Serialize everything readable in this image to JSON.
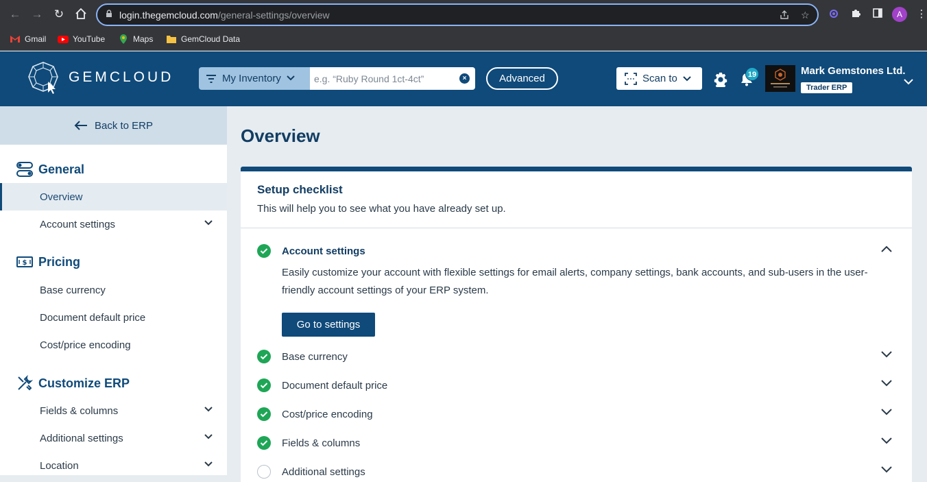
{
  "browser": {
    "url_domain": "login.thegemcloud.com",
    "url_path": "/general-settings/overview",
    "profile_initial": "A",
    "bookmarks": [
      {
        "label": "Gmail",
        "icon": "gmail-icon"
      },
      {
        "label": "YouTube",
        "icon": "youtube-icon"
      },
      {
        "label": "Maps",
        "icon": "maps-icon"
      },
      {
        "label": "GemCloud Data",
        "icon": "folder-icon"
      }
    ]
  },
  "header": {
    "logo_text": "GEMCLOUD",
    "inventory_label": "My Inventory",
    "search_placeholder": "e.g. “Ruby Round 1ct-4ct”",
    "advanced_label": "Advanced",
    "scan_label": "Scan to",
    "notification_count": "19",
    "company_name": "Mark Gemstones Ltd.",
    "erp_tag": "Trader ERP",
    "accent": "#0f4a7a"
  },
  "sidebar": {
    "back_label": "Back to ERP",
    "sections": [
      {
        "title": "General",
        "icon": "toggles-icon",
        "items": [
          {
            "label": "Overview",
            "active": true,
            "has_chevron": false
          },
          {
            "label": "Account settings",
            "has_chevron": true
          }
        ]
      },
      {
        "title": "Pricing",
        "icon": "money-icon",
        "items": [
          {
            "label": "Base currency"
          },
          {
            "label": "Document default price"
          },
          {
            "label": "Cost/price encoding"
          }
        ]
      },
      {
        "title": "Customize ERP",
        "icon": "tools-icon",
        "items": [
          {
            "label": "Fields & columns",
            "has_chevron": true
          },
          {
            "label": "Additional settings",
            "has_chevron": true
          },
          {
            "label": "Location",
            "has_chevron": true
          }
        ]
      }
    ]
  },
  "main": {
    "title": "Overview",
    "checklist": {
      "title": "Setup checklist",
      "subtitle": "This will help you to see what you have already set up.",
      "expanded": {
        "label": "Account settings",
        "description": "Easily customize your account with flexible settings for email alerts, company settings, bank accounts, and sub-users in the user-friendly account settings of your ERP system.",
        "button": "Go to settings"
      },
      "items": [
        {
          "label": "Base currency",
          "done": true
        },
        {
          "label": "Document default price",
          "done": true
        },
        {
          "label": "Cost/price encoding",
          "done": true
        },
        {
          "label": "Fields & columns",
          "done": true
        },
        {
          "label": "Additional settings",
          "done": false
        }
      ],
      "done_color": "#1ea656"
    }
  }
}
